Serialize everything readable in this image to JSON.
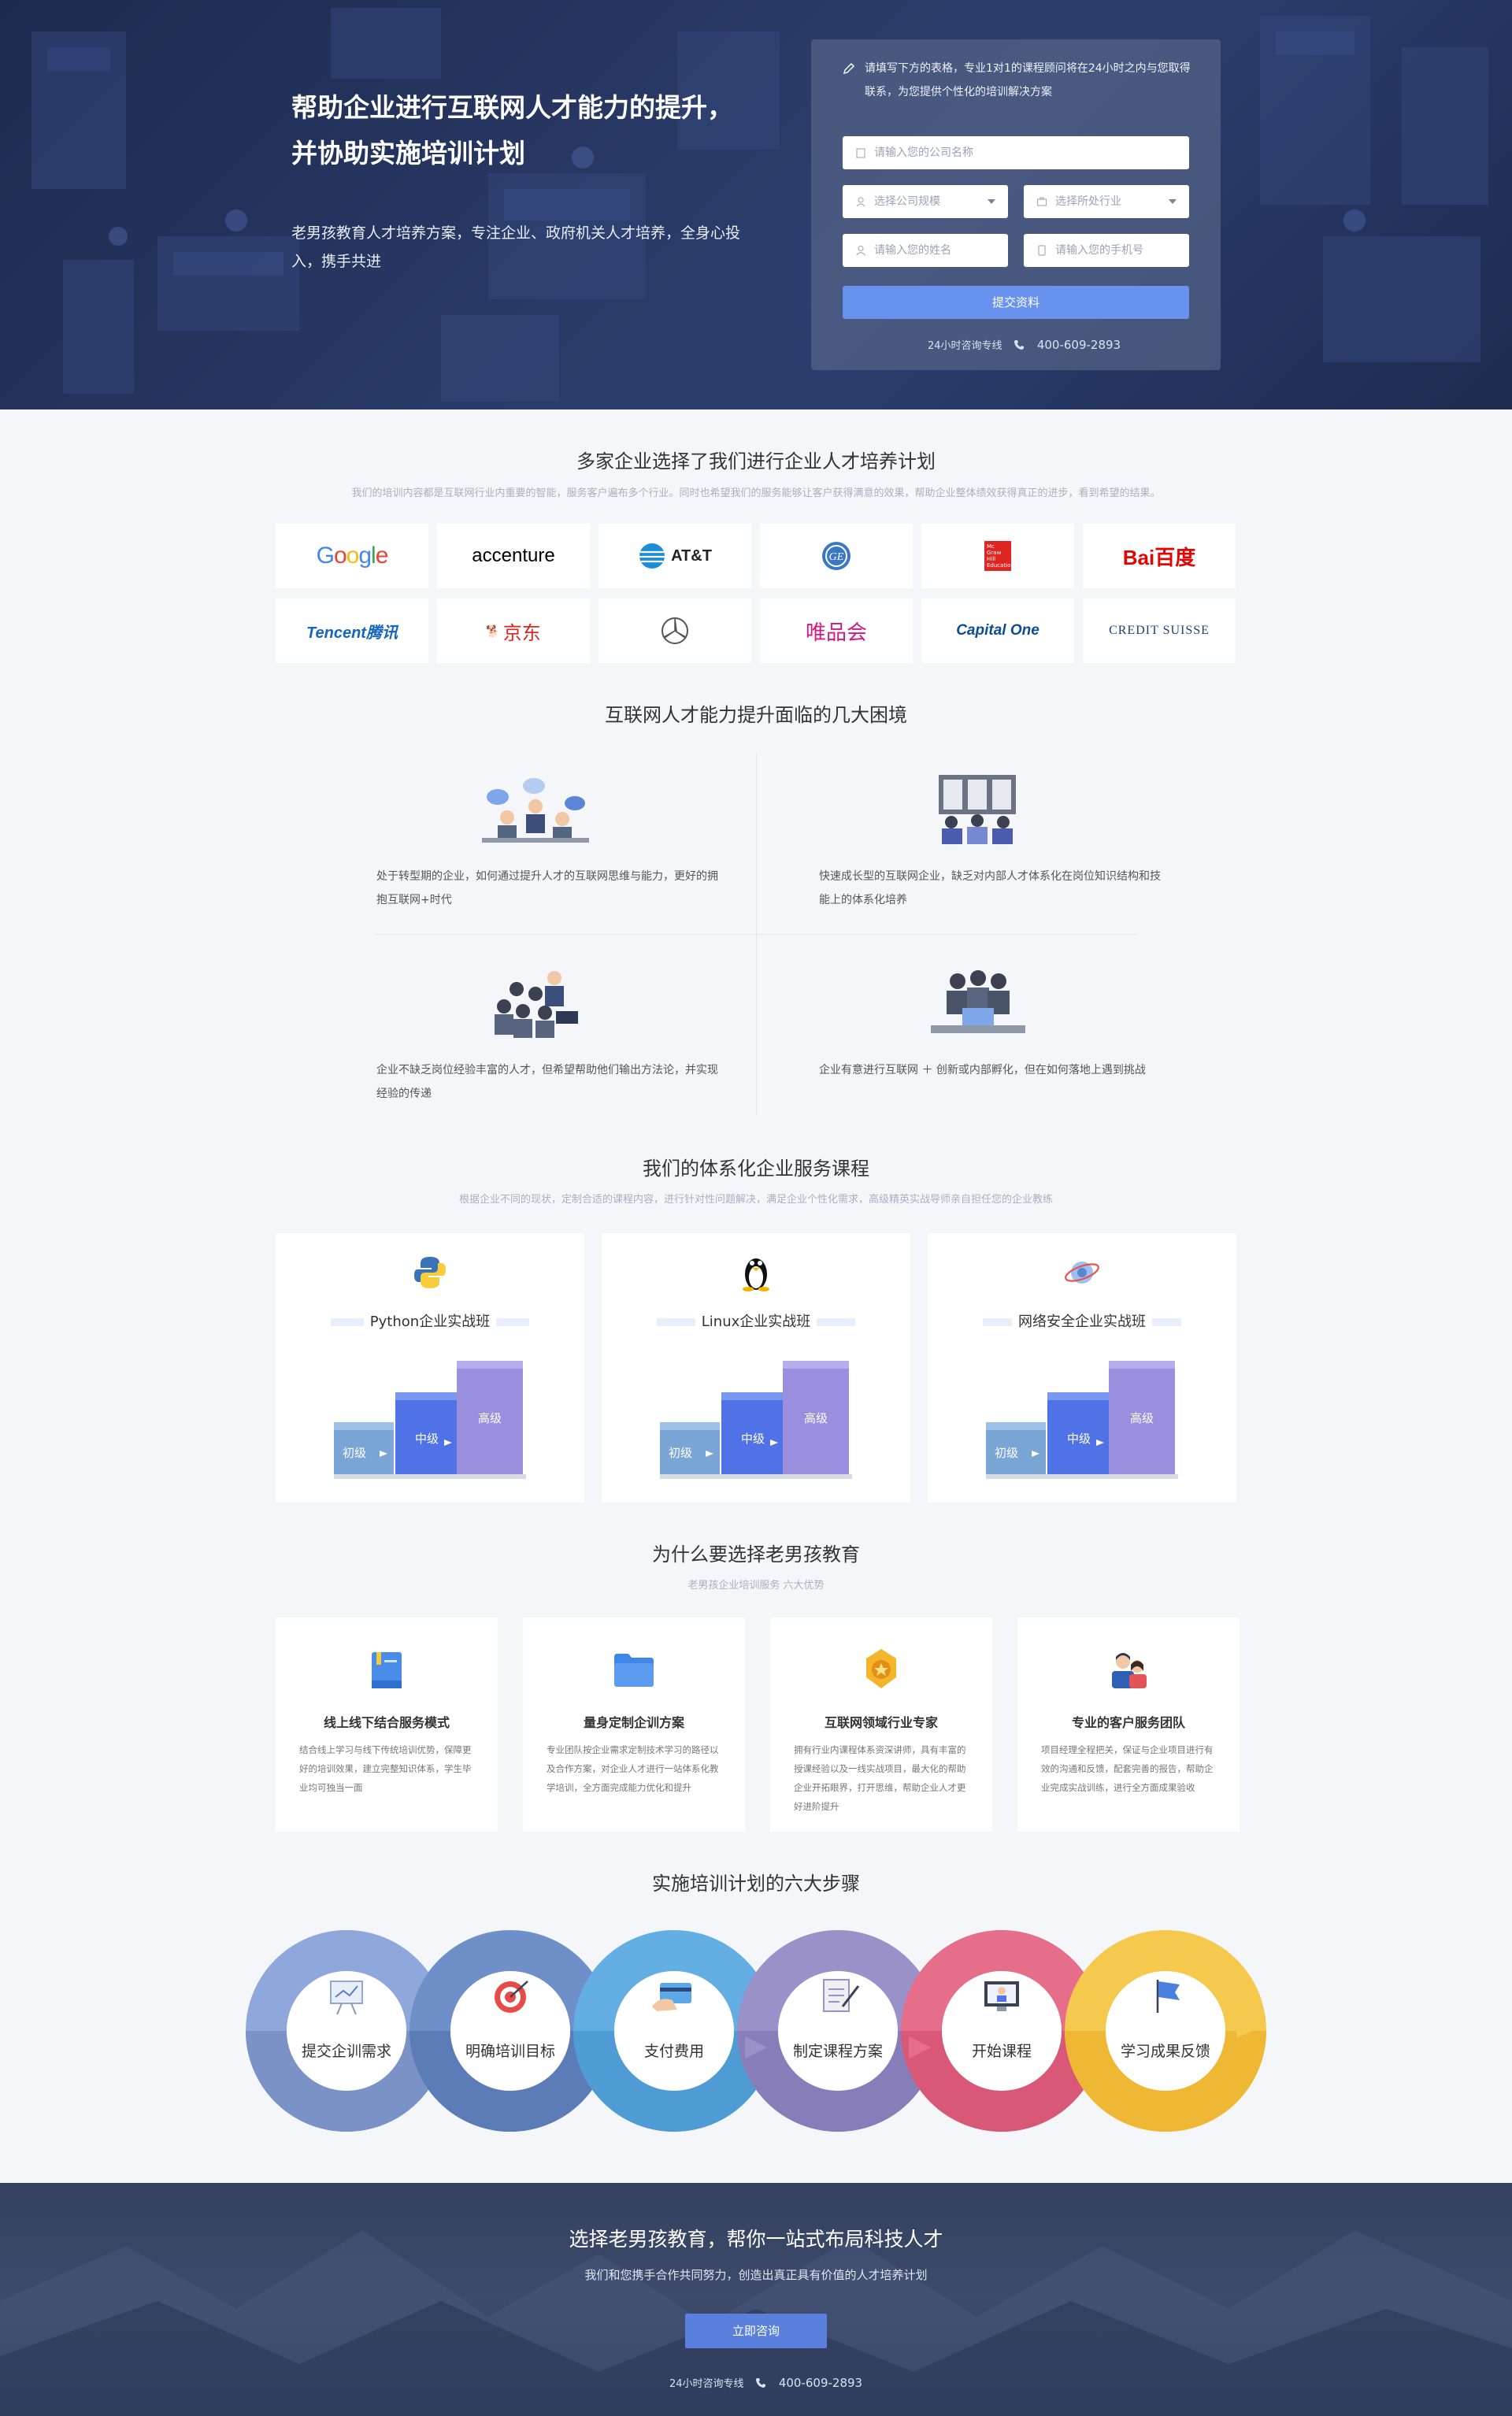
{
  "hero": {
    "title_line1": "帮助企业进行互联网人才能力的提升，",
    "title_line2": "并协助实施培训计划",
    "desc": "老男孩教育人才培养方案，专注企业、政府机关人才培养，全身心投入，携手共进"
  },
  "form": {
    "note": "请填写下方的表格，专业1对1的课程顾问将在24小时之内与您取得联系，为您提供个性化的培训解决方案",
    "company_placeholder": "请输入您的公司名称",
    "scale_placeholder": "选择公司规模",
    "industry_placeholder": "选择所处行业",
    "name_placeholder": "请输入您的姓名",
    "phone_placeholder": "请输入您的手机号",
    "submit": "提交资料",
    "hotline_label": "24小时咨询专线",
    "hotline_number": "400-609-2893"
  },
  "partners": {
    "title": "多家企业选择了我们进行企业人才培养计划",
    "subtitle": "我们的培训内容都是互联网行业内重要的智能，服务客户遍布多个行业。同时也希望我们的服务能够让客户获得满意的效果，帮助企业整体绩效获得真正的进步，看到希望的结果。",
    "logos": [
      {
        "name": "Google",
        "text": "Google"
      },
      {
        "name": "accenture",
        "text": "accenture"
      },
      {
        "name": "AT&T",
        "text": "AT&T"
      },
      {
        "name": "GE",
        "text": "GE"
      },
      {
        "name": "McGraw Hill Education",
        "text": "Mc Graw Hill Education"
      },
      {
        "name": "Baidu",
        "text": "Bai百度"
      },
      {
        "name": "Tencent",
        "text": "Tencent腾讯"
      },
      {
        "name": "JD",
        "text": "京东"
      },
      {
        "name": "Mercedes-Benz",
        "text": ""
      },
      {
        "name": "VIP",
        "text": "唯品会"
      },
      {
        "name": "Capital One",
        "text": "Capital One"
      },
      {
        "name": "Credit Suisse",
        "text": "CREDIT SUISSE"
      }
    ]
  },
  "problems": {
    "title": "互联网人才能力提升面临的几大困境",
    "items": [
      "处于转型期的企业，如何通过提升人才的互联网思维与能力，更好的拥抱互联网+时代",
      "快速成长型的互联网企业，缺乏对内部人才体系化在岗位知识结构和技能上的体系化培养",
      "企业不缺乏岗位经验丰富的人才，但希望帮助他们输出方法论，并实现经验的传递",
      "企业有意进行互联网 ＋ 创新或内部孵化，但在如何落地上遇到挑战"
    ]
  },
  "courses": {
    "title": "我们的体系化企业服务课程",
    "subtitle": "根据企业不同的现状，定制合适的课程内容，进行针对性问题解决，满足企业个性化需求，高级精英实战导师亲自担任您的企业教练",
    "items": [
      {
        "title": "Python企业实战班",
        "icon": "python-icon"
      },
      {
        "title": "Linux企业实战班",
        "icon": "linux-icon"
      },
      {
        "title": "网络安全企业实战班",
        "icon": "security-icon"
      }
    ],
    "levels": [
      "初级",
      "中级",
      "高级"
    ]
  },
  "why": {
    "title": "为什么要选择老男孩教育",
    "subtitle": "老男孩企业培训服务 六大优势",
    "items": [
      {
        "title": "线上线下结合服务模式",
        "desc": "结合线上学习与线下传统培训优势，保障更好的培训效果，建立完整知识体系，学生毕业均可独当一面",
        "icon": "book-icon"
      },
      {
        "title": "量身定制企训方案",
        "desc": "专业团队按企业需求定制技术学习的路径以及合作方案，对企业人才进行一站体系化教学培训，全方面完成能力优化和提升",
        "icon": "folder-icon"
      },
      {
        "title": "互联网领域行业专家",
        "desc": "拥有行业内课程体系资深讲师，具有丰富的授课经验以及一线实战项目，最大化的帮助企业开拓眼界，打开思维，帮助企业人才更好进阶提升",
        "icon": "medal-icon"
      },
      {
        "title": "专业的客户服务团队",
        "desc": "项目经理全程把关，保证与企业项目进行有效的沟通和反馈，配套完善的报告，帮助企业完成实战训练，进行全方面成果验收",
        "icon": "team-icon"
      }
    ]
  },
  "steps": {
    "title": "实施培训计划的六大步骤",
    "items": [
      {
        "label": "提交企训需求",
        "color": "#8fa8dc"
      },
      {
        "label": "明确培训目标",
        "color": "#6f8fc8"
      },
      {
        "label": "支付费用",
        "color": "#63afe3"
      },
      {
        "label": "制定课程方案",
        "color": "#9a91c8"
      },
      {
        "label": "开始课程",
        "color": "#e66e8a"
      },
      {
        "label": "学习成果反馈",
        "color": "#f5c84e"
      }
    ]
  },
  "footer": {
    "title": "选择老男孩教育，帮你一站式布局科技人才",
    "subtitle": "我们和您携手合作共同努力，创造出真正具有价值的人才培养计划",
    "button": "立即咨询",
    "hotline_label": "24小时咨询专线",
    "hotline_number": "400-609-2893"
  }
}
